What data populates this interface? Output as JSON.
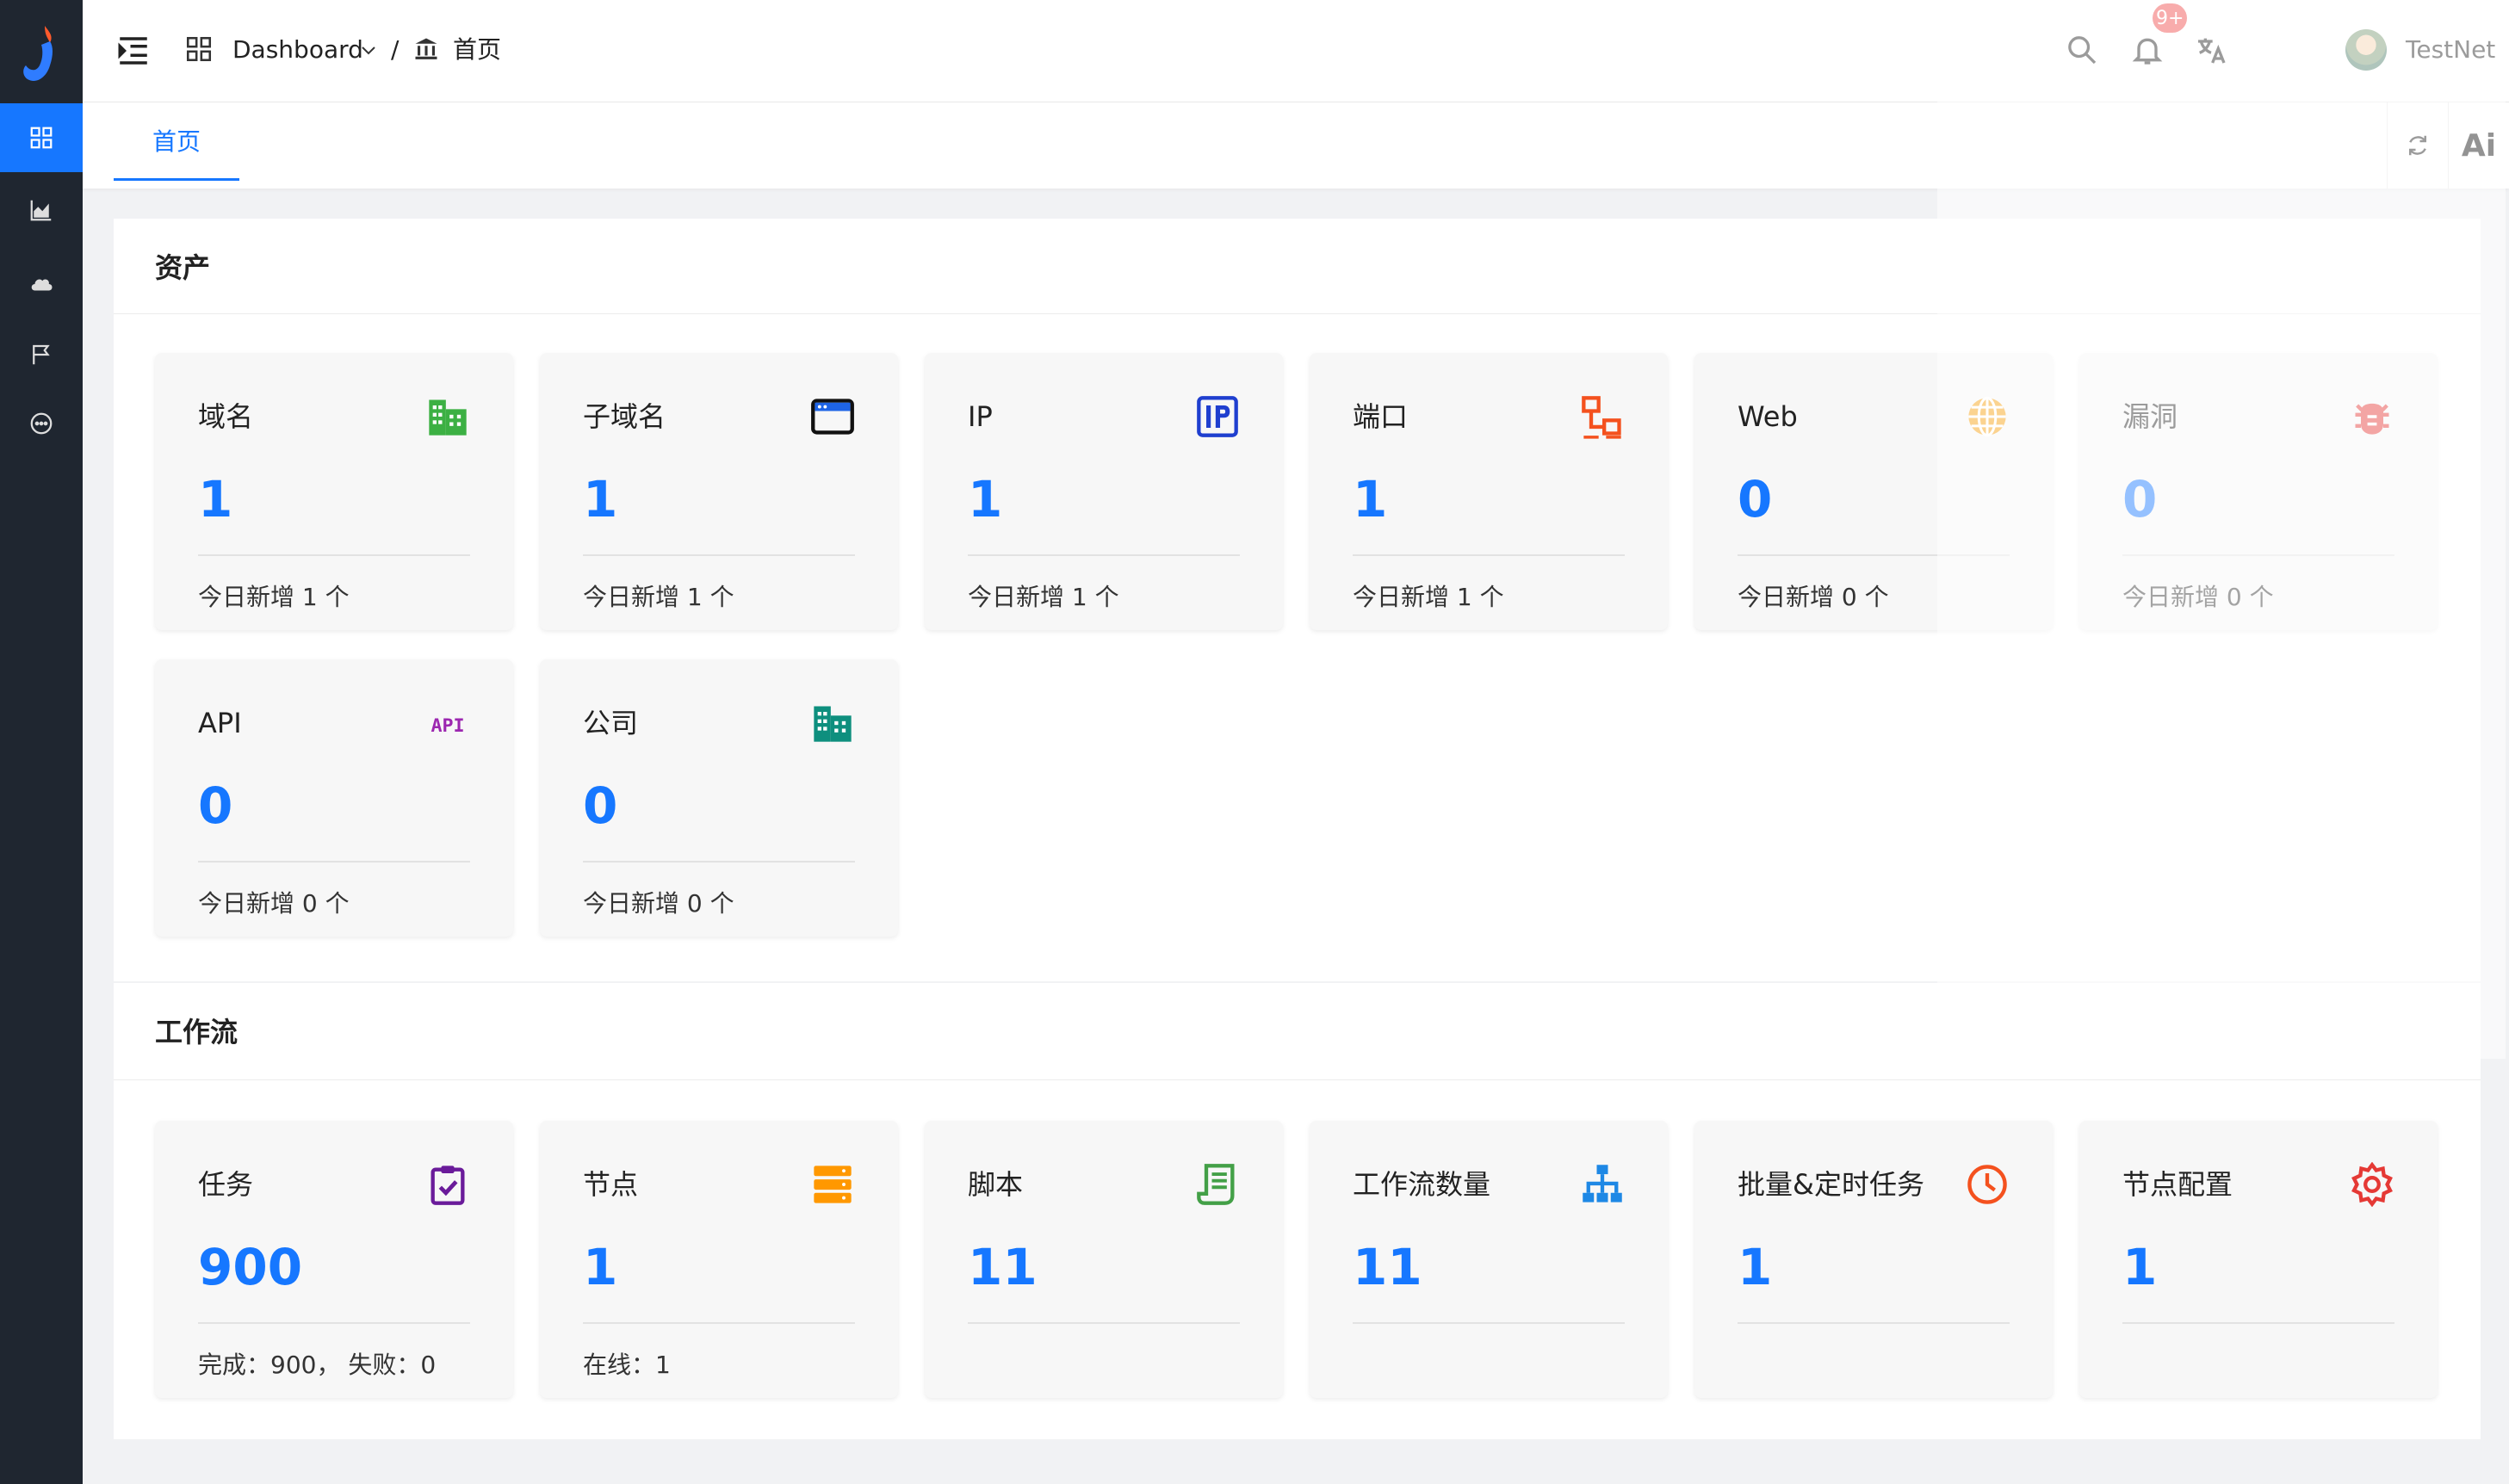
{
  "header": {
    "breadcrumb": [
      "Dashboard",
      "/",
      "首页"
    ],
    "notification_badge": "9+",
    "user_name": "TestNet"
  },
  "tabs": [
    {
      "label": "首页"
    }
  ],
  "tab_tools": {
    "ai_label": "Ai"
  },
  "sections": {
    "assets": {
      "title": "资产",
      "cards": [
        {
          "title": "域名",
          "value": "1",
          "sub": "今日新增 1 个",
          "icon": "building-icon",
          "color": "#3cb043"
        },
        {
          "title": "子域名",
          "value": "1",
          "sub": "今日新增 1 个",
          "icon": "browser-window-icon",
          "color": "#111111"
        },
        {
          "title": "IP",
          "value": "1",
          "sub": "今日新增 1 个",
          "icon": "ip-icon",
          "color": "#1f3fcf"
        },
        {
          "title": "端口",
          "value": "1",
          "sub": "今日新增 1 个",
          "icon": "network-icon",
          "color": "#f4511e"
        },
        {
          "title": "Web",
          "value": "0",
          "sub": "今日新增 0 个",
          "icon": "globe-icon",
          "color": "#f59e0b"
        },
        {
          "title": "漏洞",
          "value": "0",
          "sub": "今日新增 0 个",
          "icon": "bug-icon",
          "color": "#e53935"
        },
        {
          "title": "API",
          "value": "0",
          "sub": "今日新增 0 个",
          "icon": "api-icon",
          "color": "#9c27b0"
        },
        {
          "title": "公司",
          "value": "0",
          "sub": "今日新增 0 个",
          "icon": "company-icon",
          "color": "#0e8f7e"
        }
      ]
    },
    "workflow": {
      "title": "工作流",
      "cards": [
        {
          "title": "任务",
          "value": "900",
          "sub": "完成：900， 失败：0",
          "icon": "clipboard-check-icon",
          "color": "#6a1b9a"
        },
        {
          "title": "节点",
          "value": "1",
          "sub": "在线：1",
          "icon": "server-icon",
          "color": "#ff9800"
        },
        {
          "title": "脚本",
          "value": "11",
          "sub": "",
          "icon": "script-icon",
          "color": "#43a047"
        },
        {
          "title": "工作流数量",
          "value": "11",
          "sub": "",
          "icon": "sitemap-icon",
          "color": "#1e88e5"
        },
        {
          "title": "批量&定时任务",
          "value": "1",
          "sub": "",
          "icon": "clock-icon",
          "color": "#f4511e"
        },
        {
          "title": "节点配置",
          "value": "1",
          "sub": "",
          "icon": "gear-icon",
          "color": "#e53935"
        }
      ]
    }
  },
  "colors": {
    "accent": "#1677ff",
    "sidebar": "#1f2630"
  }
}
